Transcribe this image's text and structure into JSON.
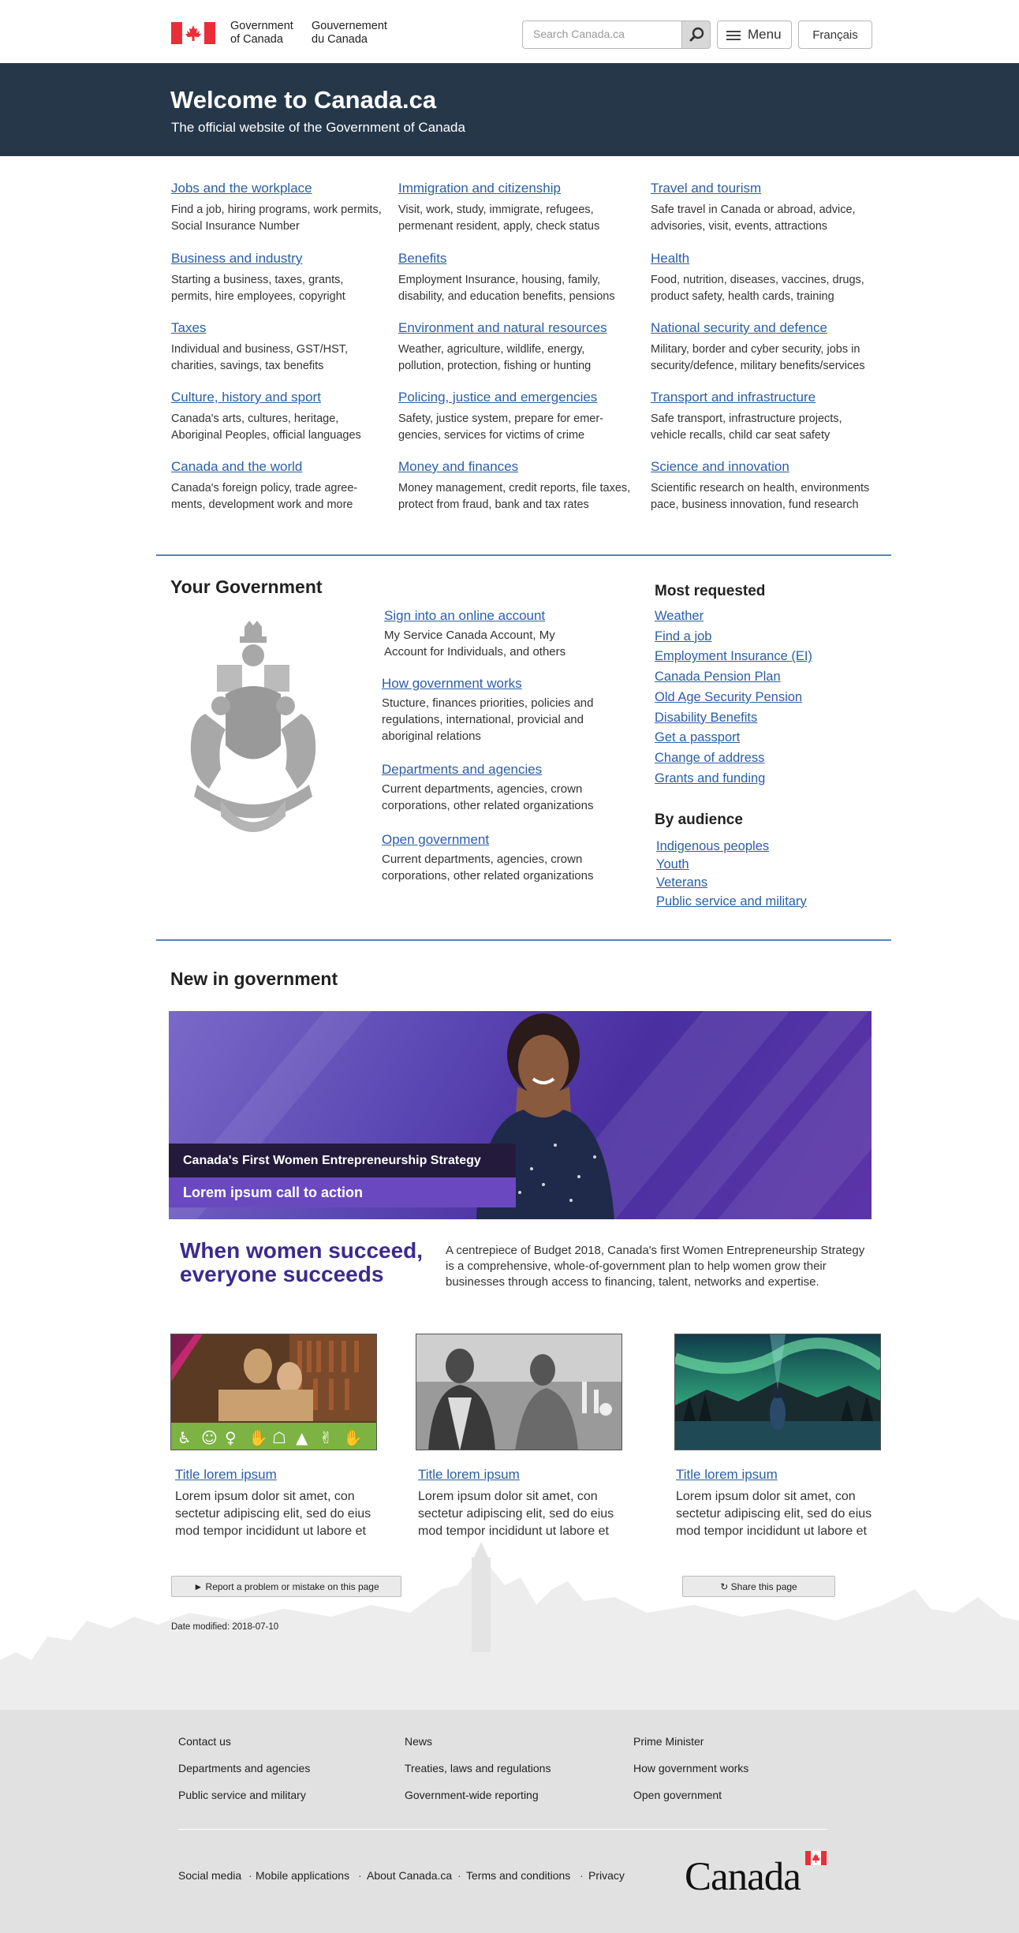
{
  "header": {
    "gov_en": [
      "Government",
      "of Canada"
    ],
    "gov_fr": [
      "Gouvernement",
      "du Canada"
    ],
    "search_placeholder": "Search Canada.ca",
    "menu_label": "Menu",
    "lang_label": "Français"
  },
  "hero": {
    "title": "Welcome to Canada.ca",
    "subtitle": "The official website of the Government of Canada"
  },
  "topics": [
    {
      "title": "Jobs and the workplace",
      "desc": "Find a job, hiring programs, work permits, Social Insurance Number"
    },
    {
      "title": "Immigration and citizenship",
      "desc": "Visit, work, study, immigrate, refugees, permenant resident, apply, check status"
    },
    {
      "title": "Travel and tourism",
      "desc": "Safe travel in Canada or abroad, advice, advisories, visit, events, attractions"
    },
    {
      "title": "Business and industry",
      "desc": "Starting a business, taxes, grants, permits, hire employees, copyright"
    },
    {
      "title": "Benefits",
      "desc": "Employment Insurance, housing, family, disability, and education benefits, pensions"
    },
    {
      "title": "Health",
      "desc": "Food, nutrition, diseases, vaccines, drugs, product safety, health cards, training"
    },
    {
      "title": "Taxes",
      "desc": "Individual and business, GST/HST, charities, savings, tax benefits"
    },
    {
      "title": "Environment and natural resources",
      "desc": "Weather, agriculture, wildlife, energy, pollution, protection, fishing or hunting"
    },
    {
      "title": "National security and defence",
      "desc": "Military, border and cyber security, jobs in security/defence, military benefits/services"
    },
    {
      "title": "Culture, history and sport",
      "desc": "Canada's arts, cultures, heritage, Aboriginal Peoples, official languages"
    },
    {
      "title": "Policing, justice and emergencies",
      "desc": "Safety, justice system, prepare for emer-gencies, services for victims of crime"
    },
    {
      "title": "Transport and infrastructure",
      "desc": "Safe transport, infrastructure projects, vehicle recalls, child car seat safety"
    },
    {
      "title": "Canada and the world",
      "desc": "Canada's foreign policy, trade agree-ments, development work and more"
    },
    {
      "title": "Money and finances",
      "desc": "Money management, credit reports, file taxes, protect from fraud, bank and tax rates"
    },
    {
      "title": "Science and innovation",
      "desc": "Scientific research on health, environments pace, business innovation, fund research"
    }
  ],
  "your_government": {
    "heading": "Your Government",
    "items": [
      {
        "title": "Sign into an online account",
        "desc": "My Service Canada Account, My Account for Individuals, and others"
      },
      {
        "title": "How government works",
        "desc": "Stucture, finances priorities, policies and regulations, international, provicial and aboriginal relations"
      },
      {
        "title": "Departments and agencies",
        "desc": "Current departments, agencies, crown corporations, other related organizations"
      },
      {
        "title": "Open government",
        "desc": "Current departments, agencies, crown corporations, other related organizations"
      }
    ]
  },
  "most_requested": {
    "heading": "Most requested",
    "items": [
      "Weather",
      "Find a job",
      "Employment Insurance (EI)",
      "Canada Pension Plan",
      "Old Age Security Pension",
      "Disability Benefits",
      "Get a passport",
      "Change of address",
      "Grants and funding"
    ]
  },
  "by_audience": {
    "heading": "By audience",
    "items": [
      "Indigenous peoples",
      "Youth",
      "Veterans",
      "Public service and military"
    ]
  },
  "new_in_government": {
    "heading": "New in government",
    "banner_caption": "Canada's First Women Entrepreneurship Strategy",
    "banner_cta": "Lorem ipsum call to action",
    "tagline": "When women succeed, everyone succeeds",
    "description": "A centrepiece of Budget 2018, Canada's first Women Entrepreneurship Strategy is a comprehensive, whole-of-government plan to help women grow their businesses through access to financing, talent, networks and expertise."
  },
  "cards": [
    {
      "title": "Title lorem ipsum",
      "desc": "Lorem ipsum dolor sit amet, con sectetur adipiscing elit, sed do eius mod tempor incididunt ut labore et"
    },
    {
      "title": "Title lorem ipsum",
      "desc": "Lorem ipsum dolor sit amet, con sectetur adipiscing elit, sed do eius mod tempor incididunt ut labore et"
    },
    {
      "title": "Title lorem ipsum",
      "desc": "Lorem ipsum dolor sit amet, con sectetur adipiscing elit, sed do eius mod tempor incididunt ut labore et"
    }
  ],
  "page_actions": {
    "report": "► Report a problem or mistake on this page",
    "share": "↻ Share this page",
    "date_modified": "Date modified: 2018-07-10"
  },
  "footer": {
    "links": [
      "Contact us",
      "News",
      "Prime Minister",
      "Departments and agencies",
      "Treaties, laws and regulations",
      "How government works",
      "Public service and military",
      "Government-wide reporting",
      "Open government"
    ],
    "sub_links": [
      "Social media",
      "Mobile applications",
      "About Canada.ca",
      "Terms and conditions",
      "Privacy"
    ],
    "wordmark": "Canada"
  },
  "colors": {
    "link": "#2b5ea6",
    "header_bg": "#26374a",
    "accent_rule": "#5b7fc4",
    "banner_purple": "#5b48b3",
    "tagline": "#3c2a8e",
    "flag_red": "#eb2d37"
  }
}
